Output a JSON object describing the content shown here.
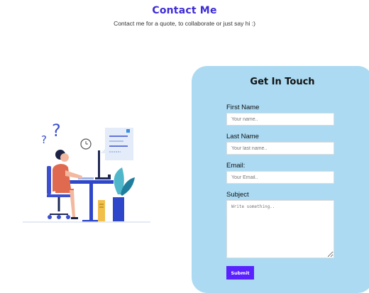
{
  "header": {
    "title": "Contact Me",
    "subtitle": "Contact me for a quote, to collaborate or just say hi :)"
  },
  "form": {
    "title": "Get In Touch",
    "first_name_label": "First Name",
    "first_name_placeholder": "Your name..",
    "last_name_label": "Last Name",
    "last_name_placeholder": "Your last name..",
    "email_label": "Email:",
    "email_placeholder": "Your Email..",
    "subject_label": "Subject",
    "subject_placeholder": "Write something..",
    "submit_label": "Submit"
  },
  "colors": {
    "accent": "#3d2cd6",
    "card_bg": "#abdaf2",
    "button_bg": "#5a22ff"
  },
  "illustration": {
    "description_icon": "woman-at-desk-illustration"
  }
}
